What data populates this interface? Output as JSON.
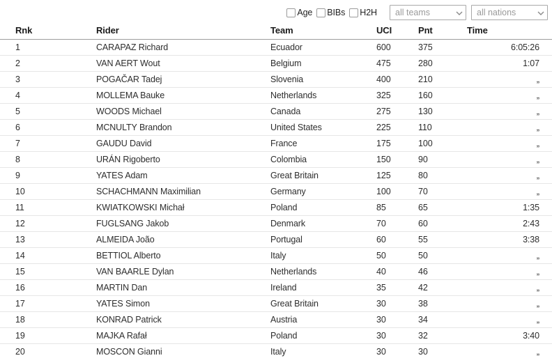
{
  "filters": {
    "checkboxes": [
      {
        "name": "age",
        "label": "Age",
        "checked": false
      },
      {
        "name": "bibs",
        "label": "BIBs",
        "checked": false
      },
      {
        "name": "h2h",
        "label": "H2H",
        "checked": false
      }
    ],
    "selects": [
      {
        "name": "teams",
        "value": "all teams"
      },
      {
        "name": "nations",
        "value": "all nations"
      }
    ],
    "caret_icon": "chevron-down-icon"
  },
  "table": {
    "columns": {
      "rnk": "Rnk",
      "rider": "Rider",
      "team": "Team",
      "uci": "UCI",
      "pnt": "Pnt",
      "time": "Time"
    },
    "rows": [
      {
        "rnk": "1",
        "rider": "CARAPAZ Richard",
        "flag": "ecuador",
        "team": "Ecuador",
        "uci": "600",
        "pnt": "375",
        "time": "6:05:26"
      },
      {
        "rnk": "2",
        "rider": "VAN AERT Wout",
        "flag": "belgium",
        "team": "Belgium",
        "uci": "475",
        "pnt": "280",
        "time": "1:07"
      },
      {
        "rnk": "3",
        "rider": "POGAČAR Tadej",
        "flag": "slovenia",
        "team": "Slovenia",
        "uci": "400",
        "pnt": "210",
        "time": "„"
      },
      {
        "rnk": "4",
        "rider": "MOLLEMA Bauke",
        "flag": "netherlands",
        "team": "Netherlands",
        "uci": "325",
        "pnt": "160",
        "time": "„"
      },
      {
        "rnk": "5",
        "rider": "WOODS Michael",
        "flag": "canada",
        "team": "Canada",
        "uci": "275",
        "pnt": "130",
        "time": "„"
      },
      {
        "rnk": "6",
        "rider": "MCNULTY Brandon",
        "flag": "united-states",
        "team": "United States",
        "uci": "225",
        "pnt": "110",
        "time": "„"
      },
      {
        "rnk": "7",
        "rider": "GAUDU David",
        "flag": "france",
        "team": "France",
        "uci": "175",
        "pnt": "100",
        "time": "„"
      },
      {
        "rnk": "8",
        "rider": "URÁN Rigoberto",
        "flag": "colombia",
        "team": "Colombia",
        "uci": "150",
        "pnt": "90",
        "time": "„"
      },
      {
        "rnk": "9",
        "rider": "YATES Adam",
        "flag": "great-britain",
        "team": "Great Britain",
        "uci": "125",
        "pnt": "80",
        "time": "„"
      },
      {
        "rnk": "10",
        "rider": "SCHACHMANN Maximilian",
        "flag": "germany",
        "team": "Germany",
        "uci": "100",
        "pnt": "70",
        "time": "„"
      },
      {
        "rnk": "11",
        "rider": "KWIATKOWSKI Michał",
        "flag": "poland",
        "team": "Poland",
        "uci": "85",
        "pnt": "65",
        "time": "1:35"
      },
      {
        "rnk": "12",
        "rider": "FUGLSANG Jakob",
        "flag": "denmark",
        "team": "Denmark",
        "uci": "70",
        "pnt": "60",
        "time": "2:43"
      },
      {
        "rnk": "13",
        "rider": "ALMEIDA João",
        "flag": "portugal",
        "team": "Portugal",
        "uci": "60",
        "pnt": "55",
        "time": "3:38"
      },
      {
        "rnk": "14",
        "rider": "BETTIOL Alberto",
        "flag": "italy",
        "team": "Italy",
        "uci": "50",
        "pnt": "50",
        "time": "„"
      },
      {
        "rnk": "15",
        "rider": "VAN BAARLE Dylan",
        "flag": "netherlands",
        "team": "Netherlands",
        "uci": "40",
        "pnt": "46",
        "time": "„"
      },
      {
        "rnk": "16",
        "rider": "MARTIN Dan",
        "flag": "ireland",
        "team": "Ireland",
        "uci": "35",
        "pnt": "42",
        "time": "„"
      },
      {
        "rnk": "17",
        "rider": "YATES Simon",
        "flag": "great-britain",
        "team": "Great Britain",
        "uci": "30",
        "pnt": "38",
        "time": "„"
      },
      {
        "rnk": "18",
        "rider": "KONRAD Patrick",
        "flag": "austria",
        "team": "Austria",
        "uci": "30",
        "pnt": "34",
        "time": "„"
      },
      {
        "rnk": "19",
        "rider": "MAJKA Rafał",
        "flag": "poland",
        "team": "Poland",
        "uci": "30",
        "pnt": "32",
        "time": "3:40"
      },
      {
        "rnk": "20",
        "rider": "MOSCON Gianni",
        "flag": "italy",
        "team": "Italy",
        "uci": "30",
        "pnt": "30",
        "time": "„"
      }
    ]
  },
  "colors": {
    "header_text": "#1a1a1a",
    "body_text": "#2d2d2d",
    "row_divider": "#e6e6e6",
    "header_divider": "#9d9d9d",
    "select_border": "#a9a9a9",
    "select_text": "#9a9a9a"
  }
}
